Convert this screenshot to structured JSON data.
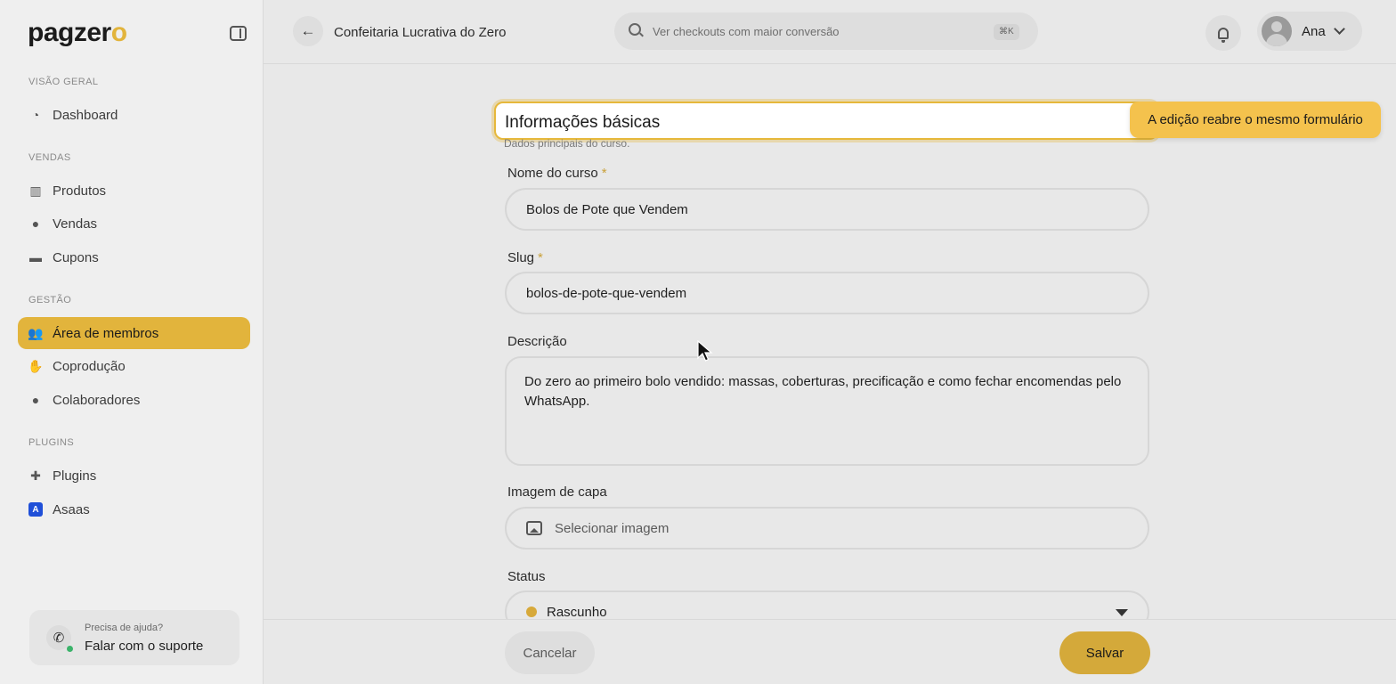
{
  "app": {
    "logo": "pagzer",
    "logo_accent": "o",
    "accent_color": "#e2b43c"
  },
  "sidebar": {
    "sections": [
      {
        "label": "VISÃO GERAL",
        "items": [
          {
            "label": "Dashboard",
            "icon": "dashboard-icon"
          }
        ]
      },
      {
        "label": "VENDAS",
        "items": [
          {
            "label": "Produtos",
            "icon": "products-icon"
          },
          {
            "label": "Vendas",
            "icon": "sales-icon"
          },
          {
            "label": "Cupons",
            "icon": "coupon-icon"
          }
        ]
      },
      {
        "label": "GESTÃO",
        "items": [
          {
            "label": "Área de membros",
            "icon": "members-icon",
            "active": true
          },
          {
            "label": "Coprodução",
            "icon": "handshake-icon"
          },
          {
            "label": "Colaboradores",
            "icon": "user-icon"
          }
        ]
      },
      {
        "label": "PLUGINS",
        "items": [
          {
            "label": "Plugins",
            "icon": "puzzle-icon"
          },
          {
            "label": "Asaas",
            "icon": "asaas-icon"
          }
        ]
      }
    ],
    "help": {
      "small": "Precisa de ajuda?",
      "big": "Falar com o suporte"
    }
  },
  "header": {
    "title": "Confeitaria Lucrativa do Zero",
    "search_placeholder": "Ver checkouts com maior conversão",
    "search_shortcut": "⌘K",
    "user_name": "Ana"
  },
  "form": {
    "section_title": "Informações básicas",
    "section_subtitle": "Dados principais do curso.",
    "tooltip": "A edição reabre o mesmo formulário",
    "fields": {
      "name": {
        "label": "Nome do curso",
        "required": "*",
        "value": "Bolos de Pote que Vendem"
      },
      "slug": {
        "label": "Slug",
        "required": "*",
        "value": "bolos-de-pote-que-vendem"
      },
      "description": {
        "label": "Descrição",
        "value": "Do zero ao primeiro bolo vendido: massas, coberturas, precificação e como fechar encomendas pelo WhatsApp."
      },
      "cover": {
        "label": "Imagem de capa",
        "placeholder": "Selecionar imagem"
      },
      "status": {
        "label": "Status",
        "value": "Rascunho",
        "dot_color": "#d7a93a"
      }
    }
  },
  "footer": {
    "cancel_label": "Cancelar",
    "save_label": "Salvar"
  }
}
